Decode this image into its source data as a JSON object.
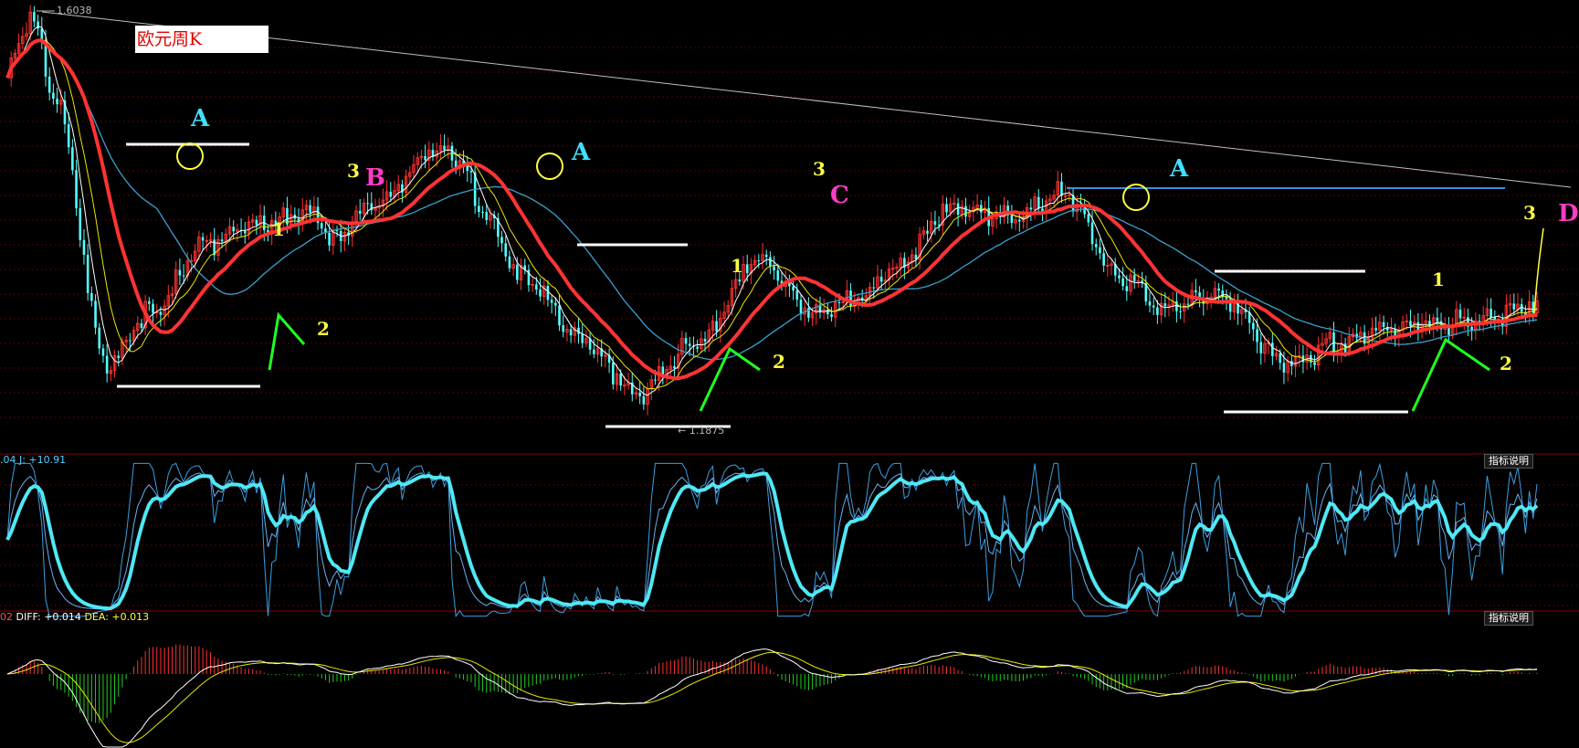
{
  "tag_label": "欧元周K",
  "price_high_label": "1.6038",
  "price_low_label": "← 1.1875",
  "kdj": {
    "text": ".04 J: +10.91",
    "explain": "指标说明"
  },
  "macd": {
    "prefix": "02",
    "diff": "DIFF: +0.014",
    "dea": "DEA: +0.013",
    "explain": "指标说明"
  },
  "colors": {
    "up": "#ff3232",
    "down": "#54ffff",
    "ma_red": "#ff3333",
    "ma_yellow": "#e8e800",
    "ma_white": "#ffffff",
    "ma_cyan": "#3aa0d0",
    "grid": "#5a0000"
  },
  "annotations": [
    {
      "text": "A",
      "color": "#40e0ff"
    },
    {
      "text": "A",
      "color": "#40e0ff"
    },
    {
      "text": "A",
      "color": "#40e0ff"
    },
    {
      "text": "B",
      "color": "#ff3cc8"
    },
    {
      "text": "C",
      "color": "#ff3cc8"
    },
    {
      "text": "D",
      "color": "#ff3cc8"
    },
    {
      "text": "3",
      "color": "#ffff40"
    },
    {
      "text": "3",
      "color": "#ffff40"
    },
    {
      "text": "3",
      "color": "#ffff40"
    },
    {
      "text": "1",
      "color": "#ffff40"
    },
    {
      "text": "1",
      "color": "#ffff40"
    },
    {
      "text": "1",
      "color": "#ffff40"
    },
    {
      "text": "2",
      "color": "#ffff40"
    },
    {
      "text": "2",
      "color": "#ffff40"
    },
    {
      "text": "2",
      "color": "#ffff40"
    }
  ],
  "chart_data": [
    {
      "type": "candlestick",
      "title": "欧元周K",
      "y_high": 1.6038,
      "y_low": 1.1875,
      "anchors": [
        [
          0,
          1.54
        ],
        [
          6,
          1.6
        ],
        [
          12,
          1.52
        ],
        [
          26,
          1.245
        ],
        [
          38,
          1.3
        ],
        [
          52,
          1.37
        ],
        [
          66,
          1.39
        ],
        [
          80,
          1.4
        ],
        [
          84,
          1.37
        ],
        [
          96,
          1.41
        ],
        [
          112,
          1.462
        ],
        [
          118,
          1.455
        ],
        [
          124,
          1.4
        ],
        [
          134,
          1.335
        ],
        [
          150,
          1.27
        ],
        [
          164,
          1.218
        ],
        [
          180,
          1.267
        ],
        [
          196,
          1.352
        ],
        [
          210,
          1.298
        ],
        [
          222,
          1.312
        ],
        [
          232,
          1.345
        ],
        [
          246,
          1.405
        ],
        [
          260,
          1.395
        ],
        [
          276,
          1.418
        ],
        [
          290,
          1.335
        ],
        [
          302,
          1.303
        ],
        [
          316,
          1.315
        ],
        [
          334,
          1.245
        ],
        [
          346,
          1.266
        ],
        [
          360,
          1.283
        ],
        [
          378,
          1.288
        ],
        [
          399,
          1.305
        ]
      ],
      "moving_averages": [
        "MA-red",
        "MA-yellow",
        "MA-white",
        "MA-cyan"
      ],
      "trendline": "descending from 1.6038"
    },
    {
      "type": "line",
      "name": "KDJ",
      "series": [
        "K",
        "D",
        "J"
      ],
      "last_J": 10.91
    },
    {
      "type": "bar+line",
      "name": "MACD",
      "series": [
        "DIFF",
        "DEA",
        "MACD"
      ],
      "last_DIFF": 0.014,
      "last_DEA": 0.013
    }
  ]
}
